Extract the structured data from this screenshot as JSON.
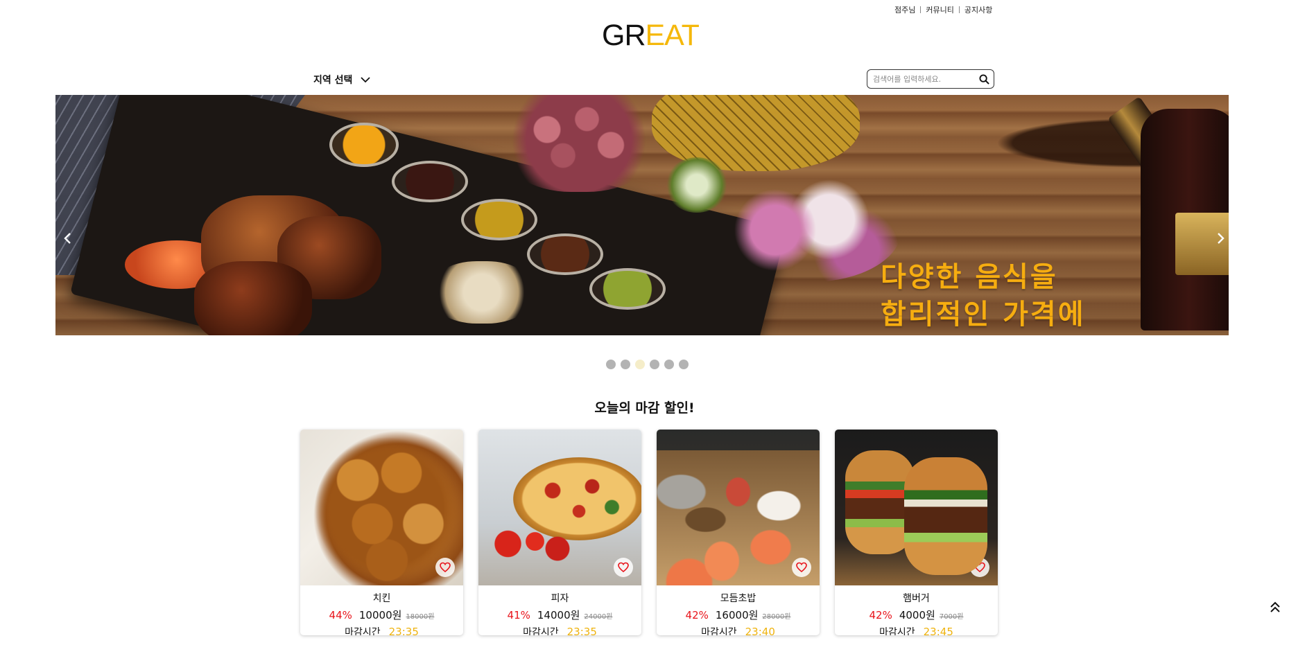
{
  "top_links": [
    {
      "label": "점주님"
    },
    {
      "label": "커뮤니티"
    },
    {
      "label": "공지사항"
    }
  ],
  "logo": {
    "part1": "GR",
    "part2": "EAT"
  },
  "region_select": {
    "label": "지역 선택",
    "icon": "chevron-down-icon"
  },
  "search": {
    "placeholder": "검색어를 입력하세요.",
    "value": "",
    "icon": "search-icon"
  },
  "banner": {
    "slogan_line1": "다양한 음식을",
    "slogan_line2": "합리적인 가격에",
    "prev_icon": "chevron-left-icon",
    "next_icon": "chevron-right-icon"
  },
  "carousel": {
    "slide_count": 6,
    "active_index": 2
  },
  "section": {
    "title": "오늘의 마감 할인!"
  },
  "deals": [
    {
      "name": "치킨",
      "rate": "44%",
      "price": "10000원",
      "original": "18000원",
      "deadline_label": "마감시간",
      "deadline": "23:35",
      "photo": "chicken"
    },
    {
      "name": "피자",
      "rate": "41%",
      "price": "14000원",
      "original": "24000원",
      "deadline_label": "마감시간",
      "deadline": "23:35",
      "photo": "pizza"
    },
    {
      "name": "모듬초밥",
      "rate": "42%",
      "price": "16000원",
      "original": "28000원",
      "deadline_label": "마감시간",
      "deadline": "23:40",
      "photo": "sushi"
    },
    {
      "name": "햄버거",
      "rate": "42%",
      "price": "4000원",
      "original": "7000원",
      "deadline_label": "마감시간",
      "deadline": "23:45",
      "photo": "burger"
    }
  ],
  "colors": {
    "brand_yellow": "#f5b80b",
    "discount_red": "#e8141b",
    "deadline_yellow": "#efb30e",
    "dot_active": "#f5edc9",
    "dot_inactive": "#b3b3b3"
  },
  "scroll_top": {
    "icon": "double-chevron-up-icon"
  }
}
